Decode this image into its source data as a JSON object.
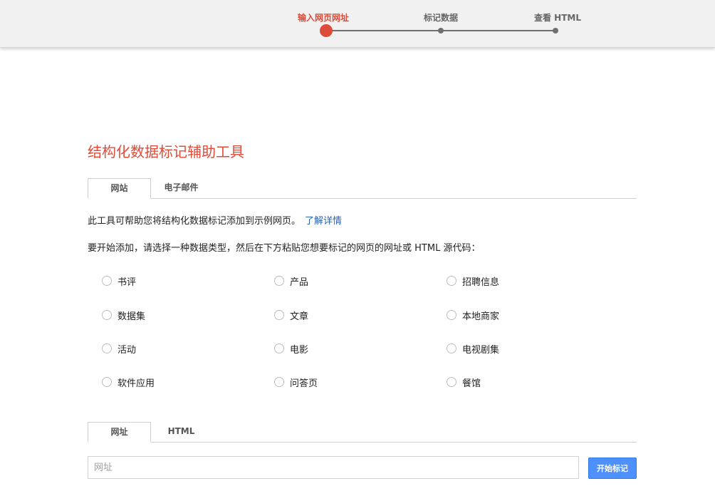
{
  "stepper": {
    "steps": [
      {
        "label": "输入网页网址",
        "active": true
      },
      {
        "label": "标记数据",
        "active": false
      },
      {
        "label": "查看 HTML",
        "active": false
      }
    ]
  },
  "main": {
    "title": "结构化数据标记辅助工具",
    "source_tabs": [
      {
        "label": "网站",
        "selected": true
      },
      {
        "label": "电子邮件",
        "selected": false
      }
    ],
    "intro_text": "此工具可帮助您将结构化数据标记添加到示例网页。",
    "learn_more_link": "了解详情",
    "instruction_text": "要开始添加，请选择一种数据类型，然后在下方粘贴您想要标记的网页的网址或 HTML 源代码：",
    "data_types": [
      [
        "书评",
        "产品",
        "招聘信息"
      ],
      [
        "数据集",
        "文章",
        "本地商家"
      ],
      [
        "活动",
        "电影",
        "电视剧集"
      ],
      [
        "软件应用",
        "问答页",
        "餐馆"
      ]
    ],
    "input_tabs": [
      {
        "label": "网址",
        "selected": true
      },
      {
        "label": "HTML",
        "selected": false
      }
    ],
    "url_input": {
      "placeholder": "网址",
      "value": ""
    },
    "start_button_label": "开始标记"
  },
  "colors": {
    "accent": "#dd4b39",
    "link": "#2860b6",
    "primary_button": "#4d90fe",
    "header_bg": "#f1f1f1"
  }
}
